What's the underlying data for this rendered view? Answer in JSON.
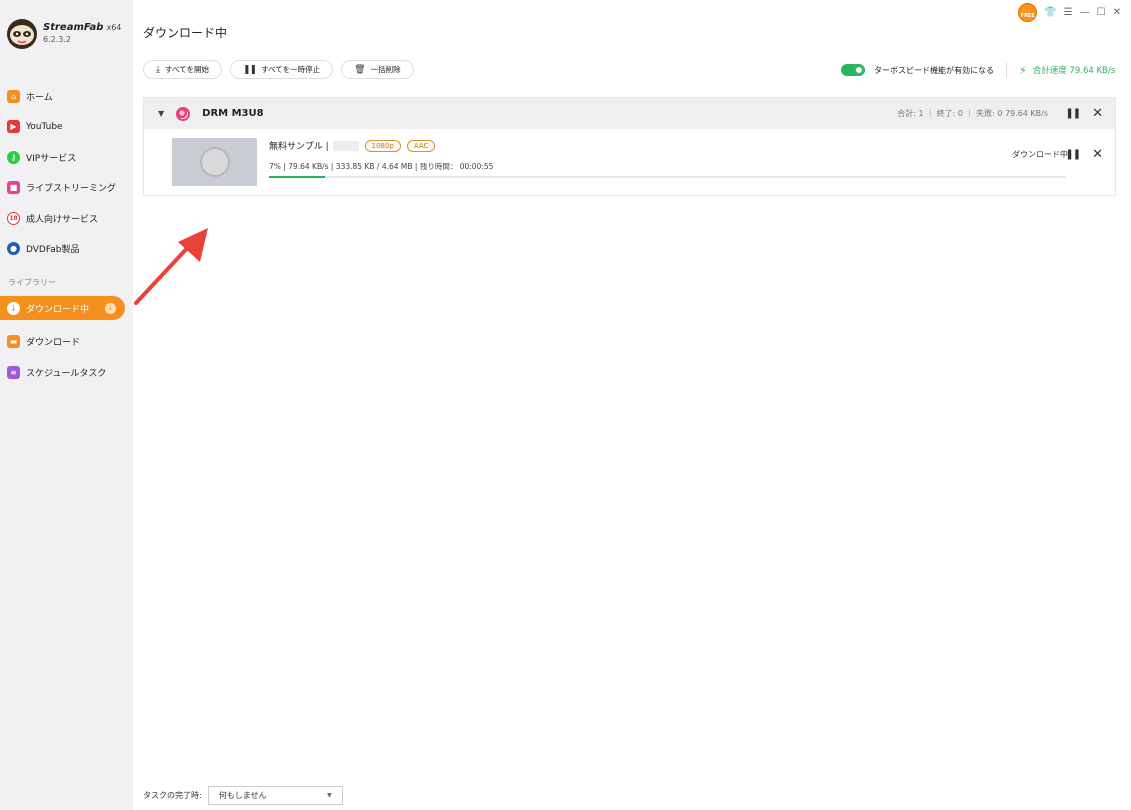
{
  "app": {
    "name": "StreamFab",
    "arch": "x64",
    "version": "6.2.3.2",
    "free_badge": "FREE"
  },
  "sidebar": {
    "items": [
      {
        "label": "ホーム",
        "icon": "home-icon",
        "color": "#f5901e"
      },
      {
        "label": "YouTube",
        "icon": "youtube-icon",
        "color": "#e53935"
      },
      {
        "label": "VIPサービス",
        "icon": "key-icon",
        "color": "#2ecc40"
      },
      {
        "label": "ライブストリーミング",
        "icon": "video-camera-icon",
        "color": "#e84393"
      },
      {
        "label": "成人向けサービス",
        "icon": "adult-restricted-icon",
        "color": "#e53935"
      },
      {
        "label": "DVDFab製品",
        "icon": "dvdfab-icon",
        "color": "#1e5fb4"
      }
    ],
    "library_header": "ライブラリー",
    "library": [
      {
        "label": "ダウンロード中",
        "icon": "download-icon",
        "active": true
      },
      {
        "label": "ダウンロード",
        "icon": "folder-icon",
        "color": "#f5901e"
      },
      {
        "label": "スケジュールタスク",
        "icon": "schedule-list-icon",
        "color": "#a259d9"
      }
    ]
  },
  "header": {
    "title": "ダウンロード中"
  },
  "toolbar": {
    "start_all": "すべてを開始",
    "pause_all": "すべてを一時停止",
    "delete_all": "一括削除"
  },
  "turbo": {
    "label": "ターボスピード機能が有効になる",
    "enabled": true,
    "speed_label": "合計速度 79.64 KB/s"
  },
  "group": {
    "title": "DRM M3U8",
    "stats": "合計: 1 ｜ 終了: 0 ｜ 失敗: 0   79.64 KB/s"
  },
  "task": {
    "name": "無料サンプル |",
    "tags": [
      "1080p",
      "AAC"
    ],
    "meta": "7%  |  79.64 KB/s  |  333.85 KB / 4.64 MB  |  残り時間：  00:00:55",
    "progress": 0.07,
    "status": "ダウンロード中"
  },
  "footer": {
    "label": "タスクの完了時:",
    "select_value": "何もしません"
  },
  "colors": {
    "accent": "#f5901e",
    "success": "#28b463",
    "arrow": "#e8423a"
  }
}
